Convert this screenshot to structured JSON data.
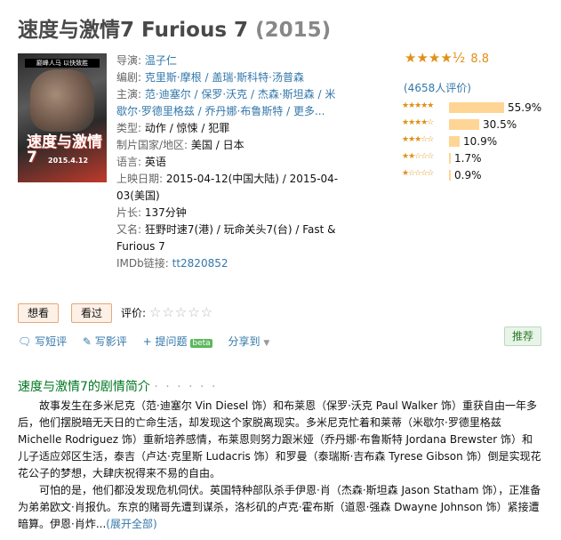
{
  "header": {
    "title": "速度与激情7 Furious 7",
    "year": "(2015)"
  },
  "poster": {
    "tagline": "巅峰人马 以快致胜",
    "title_cn": "速度与激情7",
    "date": "2015.4.12"
  },
  "info": {
    "director_label": "导演:",
    "director": "温子仁",
    "writer_label": "编剧:",
    "writers": "克里斯·摩根 / 盖瑞·斯科特·汤普森",
    "cast_label": "主演:",
    "cast": "范·迪塞尔 / 保罗·沃克 / 杰森·斯坦森 / 米歇尔·罗德里格兹 / 乔丹娜·布鲁斯特 / 更多...",
    "genre_label": "类型:",
    "genre": "动作 / 惊悚 / 犯罪",
    "country_label": "制片国家/地区:",
    "country": "美国 / 日本",
    "language_label": "语言:",
    "language": "英语",
    "release_label": "上映日期:",
    "release": "2015-04-12(中国大陆) / 2015-04-03(美国)",
    "runtime_label": "片长:",
    "runtime": "137分钟",
    "aka_label": "又名:",
    "aka": "狂野时速7(港) / 玩命关头7(台) / Fast & Furious 7",
    "imdb_label": "IMDb链接:",
    "imdb": "tt2820852"
  },
  "rating": {
    "stars": "★★★★½",
    "score": "8.8",
    "count": "(4658人评价)",
    "breakdown": [
      {
        "stars": "★★★★★",
        "percent": "55.9%",
        "value": 55.9
      },
      {
        "stars": "★★★★☆",
        "percent": "30.5%",
        "value": 30.5
      },
      {
        "stars": "★★★☆☆",
        "percent": "10.9%",
        "value": 10.9
      },
      {
        "stars": "★★☆☆☆",
        "percent": "1.7%",
        "value": 1.7
      },
      {
        "stars": "★☆☆☆☆",
        "percent": "0.9%",
        "value": 0.9
      }
    ]
  },
  "user_actions": {
    "want": "想看",
    "watched": "看过",
    "rate_label": "评价:",
    "empty_stars": "☆☆☆☆☆",
    "write_short": "写短评",
    "write_review": "写影评",
    "ask": "提问题",
    "beta": "beta",
    "share": "分享到",
    "recommend": "推荐"
  },
  "synopsis": {
    "heading": "速度与激情7的剧情简介",
    "dots": "· · · · · ·",
    "p1": "故事发生在多米尼克（范·迪塞尔 Vin Diesel 饰）和布莱恩（保罗·沃克 Paul Walker 饰）重获自由一年多后，他们摆脱暗无天日的亡命生活，却发现这个家脱离现实。多米尼克忙着和莱蒂（米歇尔·罗德里格兹 Michelle Rodriguez 饰）重新培养感情，布莱恩则努力跟米娅（乔丹娜·布鲁斯特 Jordana Brewster 饰）和儿子适应郊区生活，泰吉（卢达·克里斯 Ludacris 饰）和罗曼（泰瑞斯·吉布森 Tyrese Gibson 饰）倒是实现花花公子的梦想，大肆庆祝得来不易的自由。",
    "p2": "可怕的是，他们都没发现危机伺伏。英国特种部队杀手伊恩·肖（杰森·斯坦森 Jason Statham 饰），正准备为弟弟欧文·肖报仇。东京的赌哥先遭到谋杀，洛杉矶的卢克·霍布斯（道恩·强森 Dwayne Johnson 饰）紧接遭暗算。伊恩·肖炸...",
    "more": "(展开全部)"
  }
}
